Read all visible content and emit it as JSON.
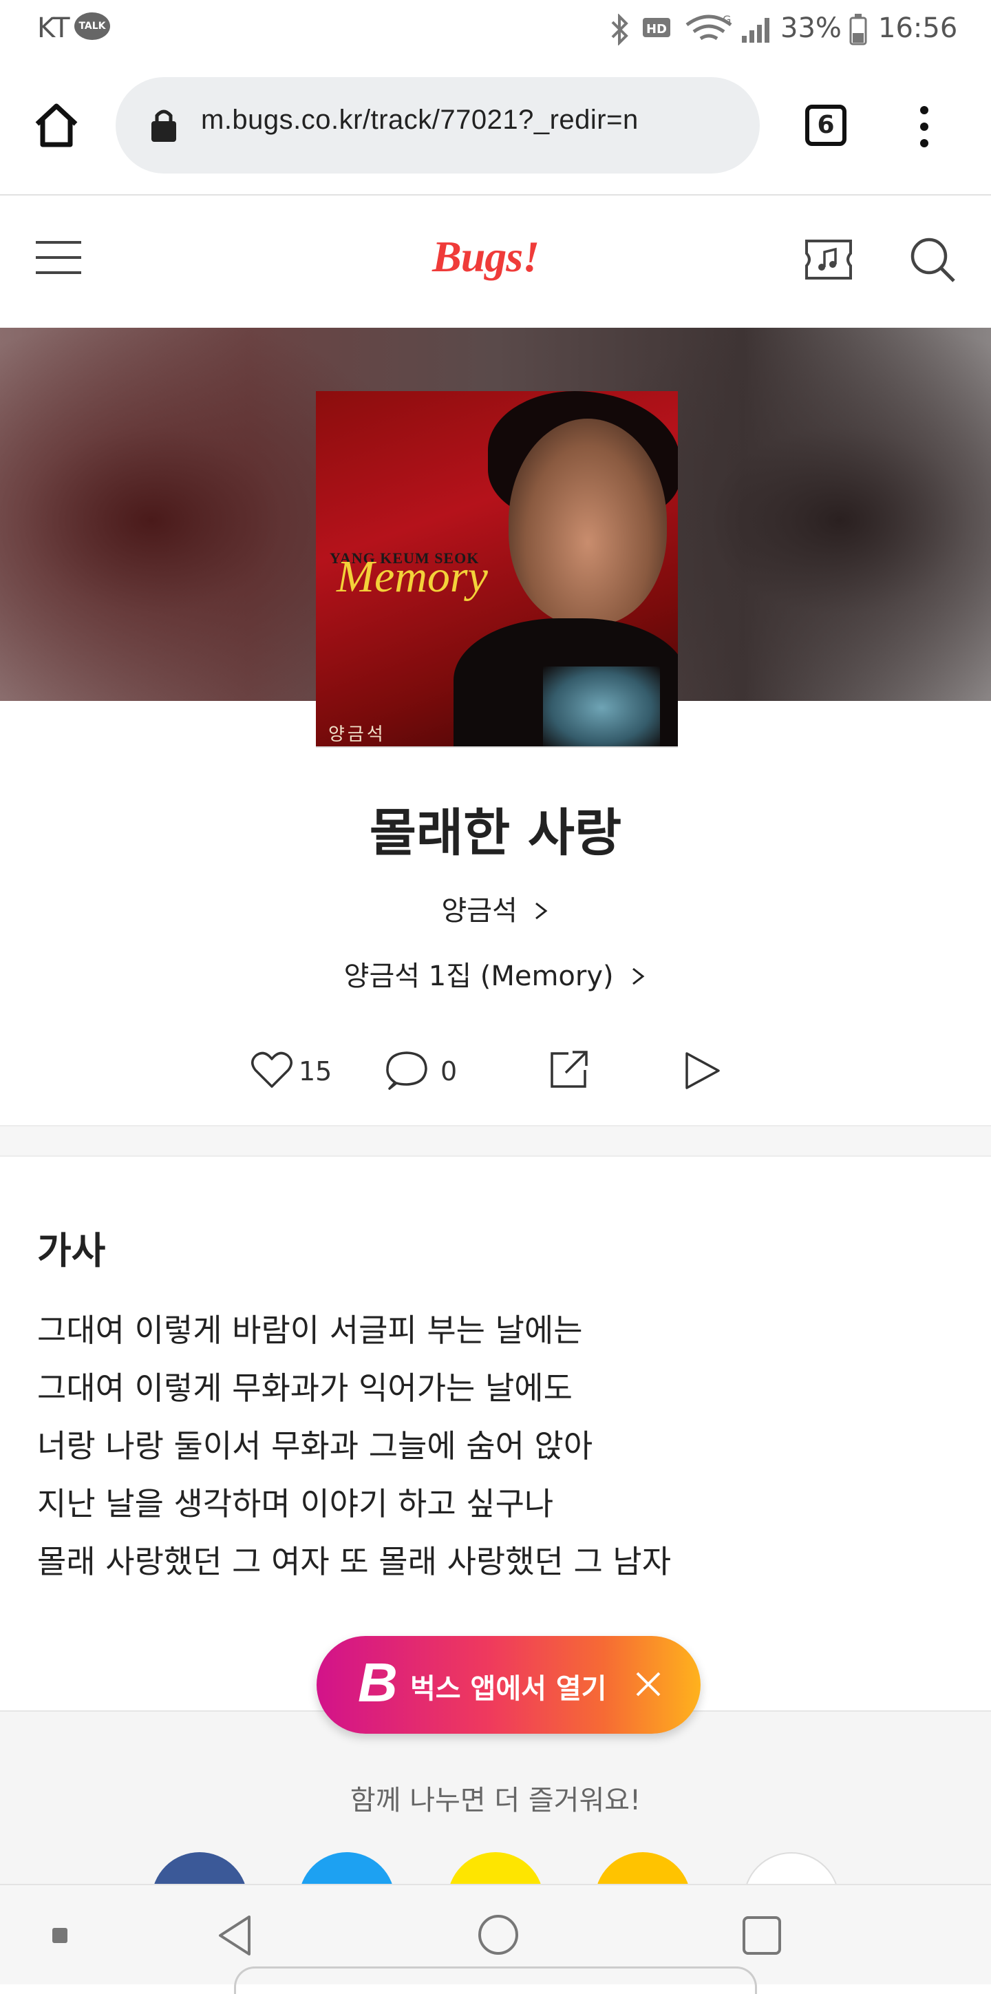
{
  "status_bar": {
    "carrier": "KT",
    "talk_badge": "TALK",
    "battery": "33%",
    "time": "16:56"
  },
  "browser": {
    "url": "m.bugs.co.kr/track/77021?_redir=n",
    "tab_count": "6"
  },
  "site": {
    "logo": "Bugs!"
  },
  "album_cover": {
    "artist_en": "YANG KEUM SEOK",
    "title_en": "Memory",
    "artist_ko": "양금석"
  },
  "track": {
    "title": "몰래한 사랑",
    "artist": "양금석",
    "album": "양금석 1집 (Memory)",
    "likes": "15",
    "comments": "0"
  },
  "lyrics": {
    "heading": "가사",
    "lines": [
      "그대여 이렇게 바람이 서글피 부는 날에는",
      "그대여 이렇게 무화과가 익어가는 날에도",
      "너랑 나랑 둘이서 무화과 그늘에 숨어 앉아",
      "지난 날을 생각하며 이야기 하고 싶구나",
      "몰래 사랑했던 그 여자 또 몰래 사랑했던 그 남자"
    ]
  },
  "app_banner": {
    "logo_letter": "B",
    "label": "벅스 앱에서 열기"
  },
  "share": {
    "text": "함께 나누면 더 즐거워요!",
    "colors": [
      "#3b5998",
      "#1da1f2",
      "#fee500",
      "#ffc300",
      "#ffffff"
    ]
  },
  "colors": {
    "brand": "#ef3b39"
  }
}
